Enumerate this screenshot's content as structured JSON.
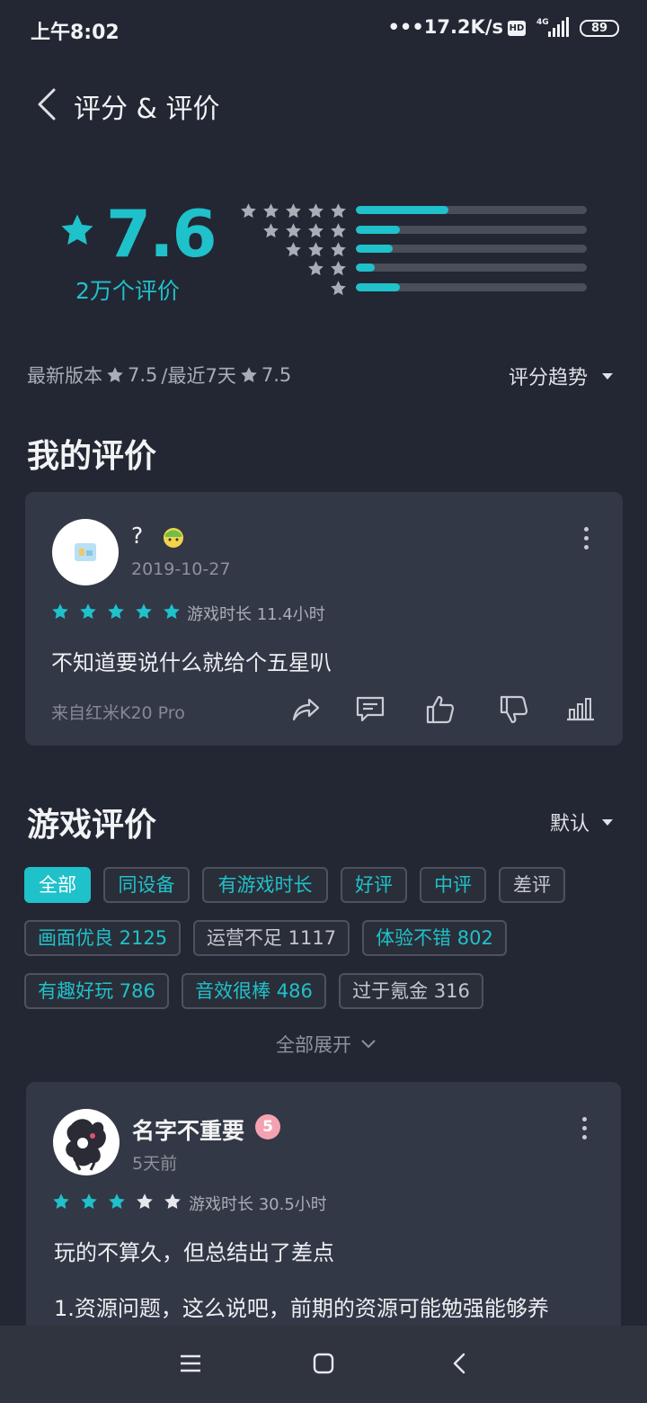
{
  "status_bar": {
    "time": "上午8:02",
    "net_speed": "•••17.2K/s",
    "hd": "HD",
    "network": "4G",
    "battery": "89"
  },
  "header": {
    "title": "评分 & 评价"
  },
  "rating": {
    "score": "7.6",
    "count_label": "2万个评价",
    "distribution": [
      {
        "stars": 5,
        "fraction": 0.4
      },
      {
        "stars": 4,
        "fraction": 0.19
      },
      {
        "stars": 3,
        "fraction": 0.16
      },
      {
        "stars": 2,
        "fraction": 0.08
      },
      {
        "stars": 1,
        "fraction": 0.19
      }
    ],
    "latest_version_label": "最新版本",
    "latest_version_score": "7.5",
    "recent_label": "/最近7天",
    "recent_score": "7.5",
    "trend_label": "评分趋势"
  },
  "my_review": {
    "section_title": "我的评价",
    "username": "?",
    "date": "2019-10-27",
    "stars": 5,
    "playtime": "游戏时长 11.4小时",
    "text": "不知道要说什么就给个五星叭",
    "device": "来自红米K20 Pro"
  },
  "game_reviews": {
    "section_title": "游戏评价",
    "sort_label": "默认",
    "tags": [
      "全部",
      "同设备",
      "有游戏时长",
      "好评",
      "中评",
      "差评",
      "画面优良 2125",
      "运营不足 1117",
      "体验不错 802",
      "有趣好玩 786",
      "音效很棒 486",
      "过于氪金 316"
    ],
    "expand_label": "全部展开"
  },
  "review1": {
    "username": "名字不重要",
    "badge": "5",
    "date": "5天前",
    "stars": 3,
    "playtime": "游戏时长 30.5小时",
    "line1": "玩的不算久，但总结出了差点",
    "line2": "1.资源问题，这么说吧，前期的资源可能勉强能够养"
  },
  "colors": {
    "accent": "#1fc1ca",
    "background": "#232733",
    "card": "#333846",
    "star_off": "#a9adb6"
  },
  "icons": [
    "back-arrow-icon",
    "star-icon",
    "share-icon",
    "comment-icon",
    "thumbs-up-icon",
    "thumbs-down-icon",
    "stats-icon",
    "more-icon",
    "menu-icon",
    "home-icon",
    "back-icon"
  ]
}
